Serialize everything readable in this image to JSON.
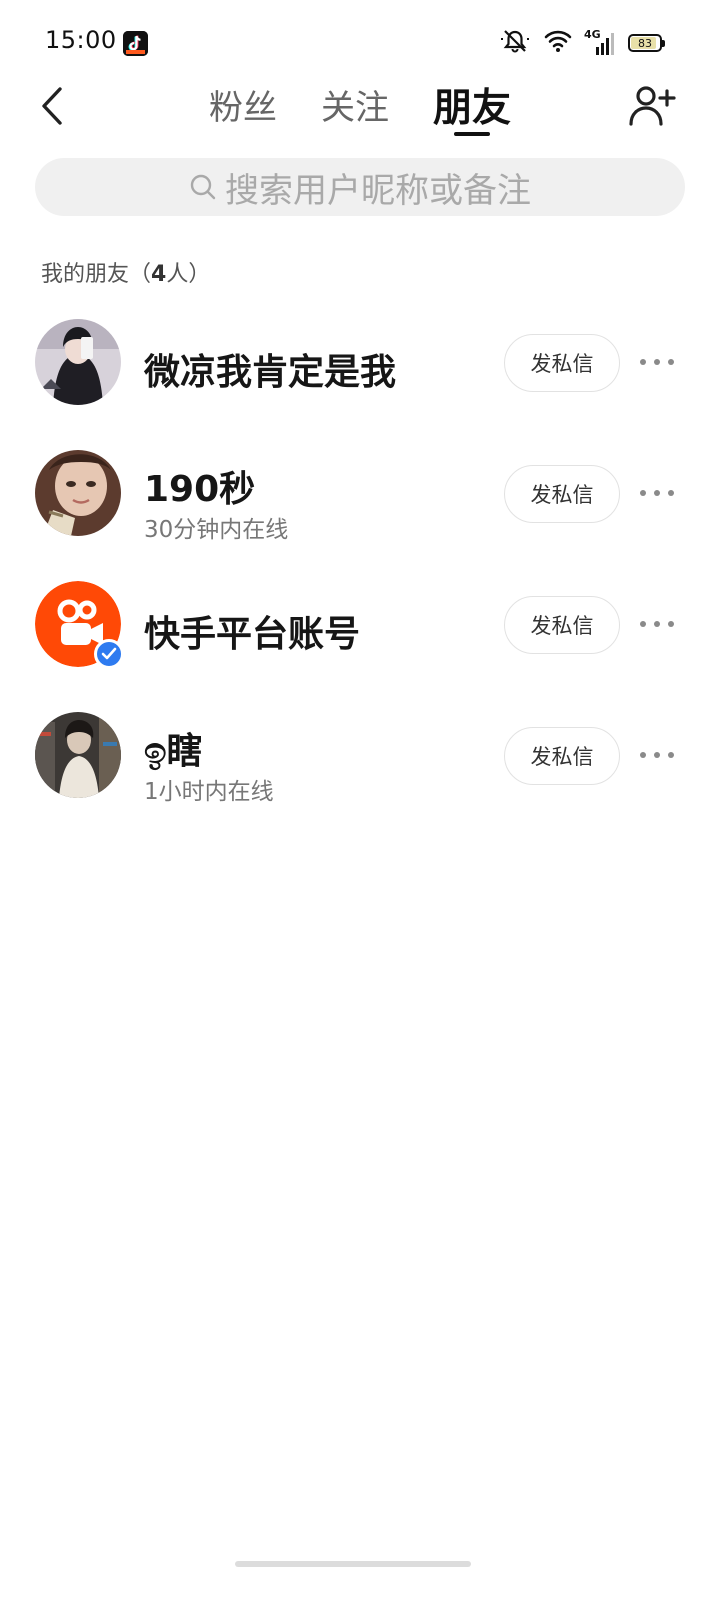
{
  "status_bar": {
    "time": "15:00",
    "network": "4G",
    "battery": "83",
    "battery_level": 0.83,
    "icons": [
      "tiktok-app-icon",
      "mute-bell-icon",
      "wifi-icon",
      "signal-4g-icon",
      "battery-icon"
    ]
  },
  "header": {
    "back_icon": "chevron-left-icon",
    "tabs": [
      {
        "label": "粉丝",
        "active": false
      },
      {
        "label": "关注",
        "active": false
      },
      {
        "label": "朋友",
        "active": true
      }
    ],
    "add_friend_icon": "add-user-icon"
  },
  "search": {
    "placeholder": "搜索用户昵称或备注",
    "icon": "search-icon"
  },
  "section": {
    "prefix": "我的朋友（",
    "count": "4",
    "suffix": "人）"
  },
  "friends": [
    {
      "name": "微凉我肯定是我",
      "status": "",
      "verified": false,
      "dm_label": "发私信",
      "avatar_colors": [
        "#2b2b33",
        "#c9c2cc"
      ]
    },
    {
      "name": "190秒",
      "status": "30分钟内在线",
      "verified": false,
      "dm_label": "发私信",
      "avatar_colors": [
        "#6b4a3a",
        "#d8b8a0"
      ]
    },
    {
      "name": "快手平台账号",
      "status": "",
      "verified": true,
      "dm_label": "发私信",
      "avatar_colors": [
        "#ff4906",
        "#ffffff"
      ]
    },
    {
      "name": "ඉ瞎",
      "status": "1小时内在线",
      "verified": false,
      "dm_label": "发私信",
      "avatar_colors": [
        "#2c2a28",
        "#a89a88"
      ]
    }
  ],
  "colors": {
    "accent_verified": "#2e7bf0",
    "kuaishou_orange": "#ff4906",
    "dm_border": "#e2e2e2",
    "search_bg": "#f0f0f0"
  }
}
